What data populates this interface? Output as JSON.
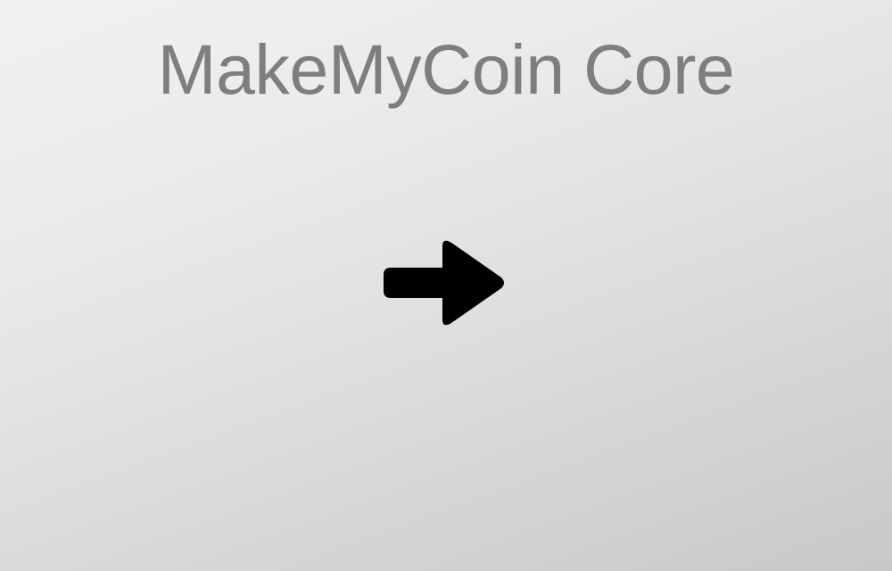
{
  "splash": {
    "title": "MakeMyCoin Core",
    "icon": "arrow-right-icon",
    "colors": {
      "title": "#7e7e7e",
      "icon": "#000000",
      "background_light": "#f1f1f1",
      "background_dark": "#c8c8c8"
    }
  }
}
